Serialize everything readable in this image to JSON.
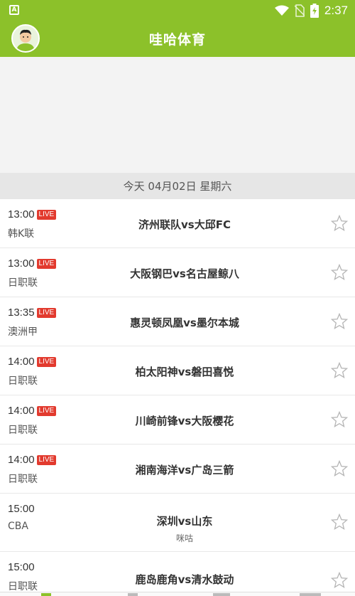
{
  "status_bar": {
    "time": "2:37",
    "notification_icon": "A"
  },
  "header": {
    "title": "哇哈体育"
  },
  "date_bar": {
    "text": "今天 04月02日 星期六"
  },
  "live_label": "LIVE",
  "matches": [
    {
      "time": "13:00",
      "live": true,
      "league": "韩K联",
      "teams": "济州联队vs大邱FC",
      "sub": ""
    },
    {
      "time": "13:00",
      "live": true,
      "league": "日职联",
      "teams": "大阪钢巴vs名古屋鲸八",
      "sub": ""
    },
    {
      "time": "13:35",
      "live": true,
      "league": "澳洲甲",
      "teams": "惠灵顿凤凰vs墨尔本城",
      "sub": ""
    },
    {
      "time": "14:00",
      "live": true,
      "league": "日职联",
      "teams": "柏太阳神vs磐田喜悦",
      "sub": ""
    },
    {
      "time": "14:00",
      "live": true,
      "league": "日职联",
      "teams": "川崎前锋vs大阪樱花",
      "sub": ""
    },
    {
      "time": "14:00",
      "live": true,
      "league": "日职联",
      "teams": "湘南海洋vs广岛三箭",
      "sub": ""
    },
    {
      "time": "15:00",
      "live": false,
      "league": "CBA",
      "teams": "深圳vs山东",
      "sub": "咪咕"
    },
    {
      "time": "15:00",
      "live": false,
      "league": "日职联",
      "teams": "鹿岛鹿角vs清水鼓动",
      "sub": ""
    }
  ],
  "colors": {
    "brand_green": "#8cc12a",
    "live_red": "#e23a2e"
  }
}
